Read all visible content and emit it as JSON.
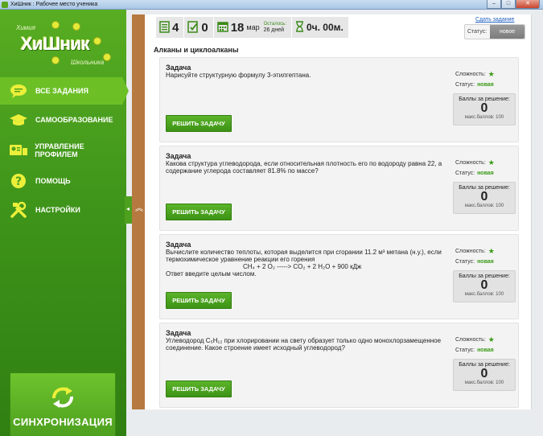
{
  "window": {
    "title": "ХиШник : Рабочее место ученика"
  },
  "logo": {
    "top": "Химия",
    "main": "ХиШник",
    "bottom": "Школьника"
  },
  "nav": [
    {
      "label": "ВСЕ ЗАДАНИЯ",
      "icon": "speech-bubble-icon",
      "active": true
    },
    {
      "label": "САМООБРАЗОВАНИЕ",
      "icon": "graduation-cap-icon"
    },
    {
      "label": "УПРАВЛЕНИЕ ПРОФИЛЕМ",
      "icon": "profile-card-icon"
    },
    {
      "label": "ПОМОЩЬ",
      "icon": "question-icon"
    },
    {
      "label": "НАСТРОЙКИ",
      "icon": "tools-icon"
    }
  ],
  "sync": {
    "label": "СИНХРОНИЗАЦИЯ",
    "icon": "sync-arrows-icon"
  },
  "stats": {
    "tasks": "4",
    "solved": "0",
    "day": "18",
    "month": "мар",
    "left_label": "Осталось:",
    "left_value": "26 дней",
    "time": "0ч. 00м."
  },
  "submit_link": "Сдать задание",
  "status": {
    "label": "Статус:",
    "value": "новое"
  },
  "section_title": "Алканы и циклоалканы",
  "tasks": [
    {
      "title": "Задача",
      "text": "Нарисуйте структурную формулу 3-этилгептана.",
      "button": "РЕШИТЬ ЗАДАЧУ",
      "difficulty_label": "Сложность:",
      "status_label": "Статус:",
      "status_value": "новая",
      "score_label": "Баллы за решение:",
      "score": "0",
      "max": "макс.баллов: 100"
    },
    {
      "title": "Задача",
      "text": "Какова структура углеводорода, если относительная плотность его по водороду равна 22, а содержание углерода составляет 81.8% по массе?",
      "button": "РЕШИТЬ ЗАДАЧУ",
      "difficulty_label": "Сложность:",
      "status_label": "Статус:",
      "status_value": "новая",
      "score_label": "Баллы за решение:",
      "score": "0",
      "max": "макс.баллов: 100"
    },
    {
      "title": "Задача",
      "text": "Вычислите количество теплоты, которая выделится при сгорании 11.2 м³ метана (н.у.), если термохимическое уравнение реакции его горения",
      "equation": "CH₄ + 2 O₂ -----> CO₂ + 2 H₂O + 900 кДж",
      "text2": "Ответ введите целым числом.",
      "button": "РЕШИТЬ ЗАДАЧУ",
      "difficulty_label": "Сложность:",
      "status_label": "Статус:",
      "status_value": "новая",
      "score_label": "Баллы за решение:",
      "score": "0",
      "max": "макс.баллов: 100"
    },
    {
      "title": "Задача",
      "text": "Углеводород C₅H₁₂ при хлорировании на свету образует только одно монохлорзамещенное соединение. Какое строение имеет исходный углеводород?",
      "button": "РЕШИТЬ ЗАДАЧУ",
      "difficulty_label": "Сложность:",
      "status_label": "Статус:",
      "status_value": "новая",
      "score_label": "Баллы за решение:",
      "score": "0",
      "max": "макс.баллов: 100"
    }
  ],
  "colors": {
    "accent": "#4ea01f",
    "splitter": "#b6793f",
    "link": "#2060c0"
  }
}
